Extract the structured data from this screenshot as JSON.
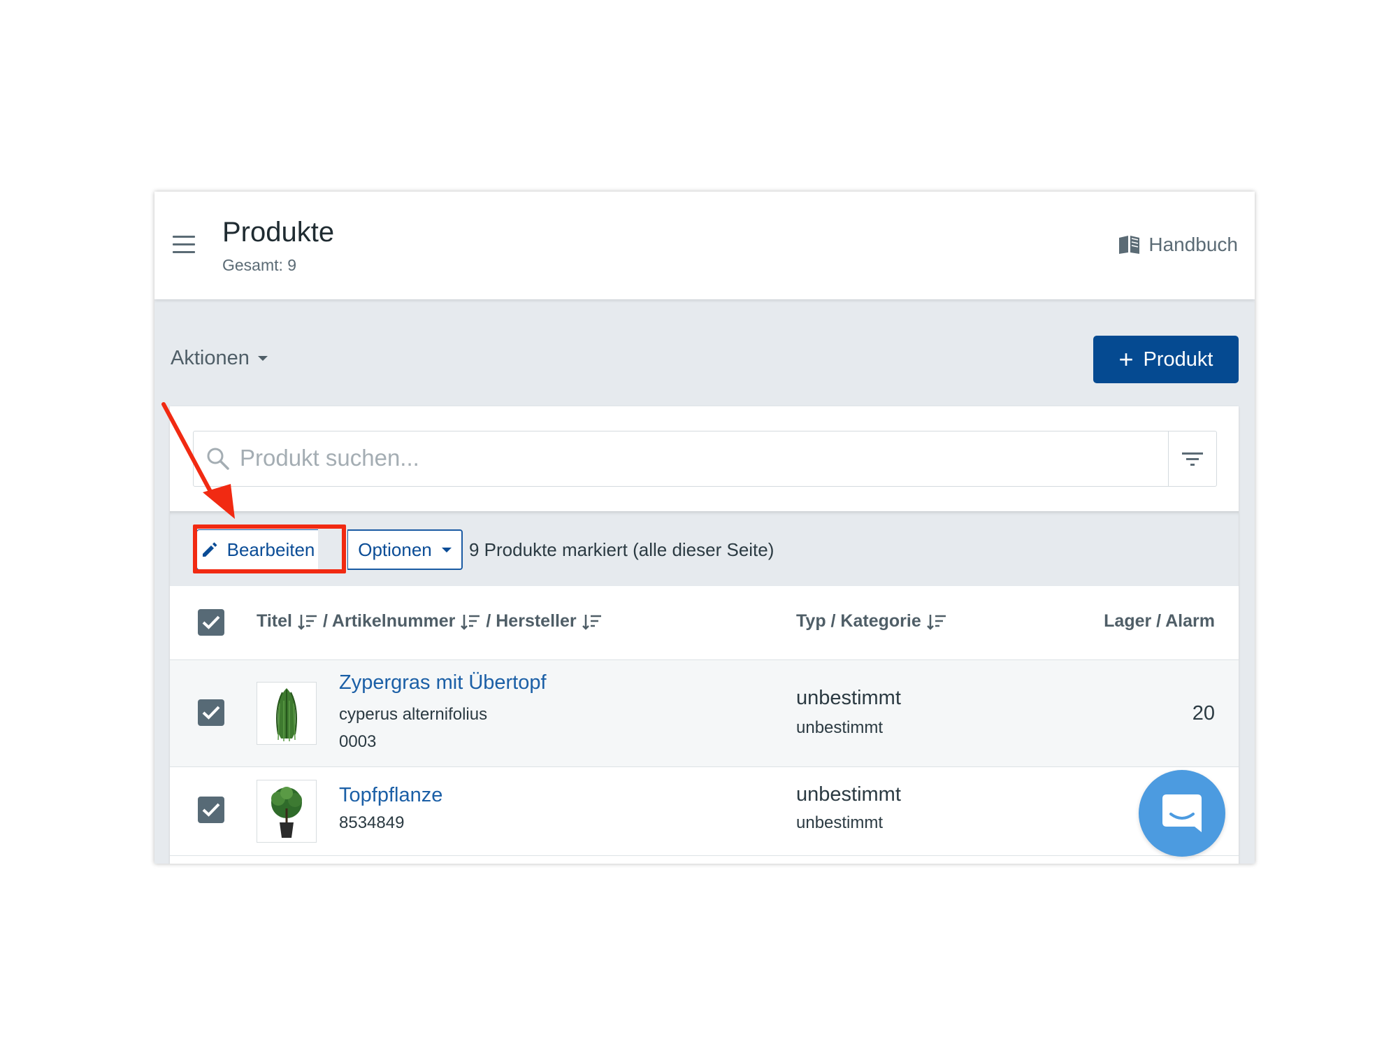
{
  "header": {
    "title": "Produkte",
    "subtitle": "Gesamt: 9",
    "manual_label": "Handbuch"
  },
  "toolbar": {
    "actions_label": "Aktionen",
    "add_product_label": "Produkt"
  },
  "search": {
    "placeholder": "Produkt suchen..."
  },
  "bulk_actions": {
    "edit_label": "Bearbeiten",
    "options_label": "Optionen",
    "selection_text": "9 Produkte markiert (alle dieser Seite)"
  },
  "table": {
    "columns": {
      "title": "Titel",
      "sku": "/ Artikelnummer",
      "manufacturer": "/ Hersteller",
      "type_category": "Typ / Kategorie",
      "stock_alarm": "Lager / Alarm"
    },
    "rows": [
      {
        "title": "Zypergras mit Übertopf",
        "line1": "cyperus alternifolius",
        "line2": "0003",
        "type": "unbestimmt",
        "category": "unbestimmt",
        "stock": "20",
        "checked": true
      },
      {
        "title": "Topfpflanze",
        "line1": "8534849",
        "line2": "",
        "type": "unbestimmt",
        "category": "unbestimmt",
        "stock": "",
        "checked": true
      }
    ]
  },
  "colors": {
    "primary": "#054a91",
    "link": "#1b5fa6",
    "checkbox": "#576a76",
    "highlight": "#f12a12",
    "chat": "#4c9be0"
  },
  "icons": [
    "menu-icon",
    "book-icon",
    "plus-icon",
    "chevron-down-icon",
    "search-icon",
    "filter-icon",
    "pencil-icon",
    "check-icon",
    "sort-icon",
    "chat-icon",
    "plant-image"
  ]
}
